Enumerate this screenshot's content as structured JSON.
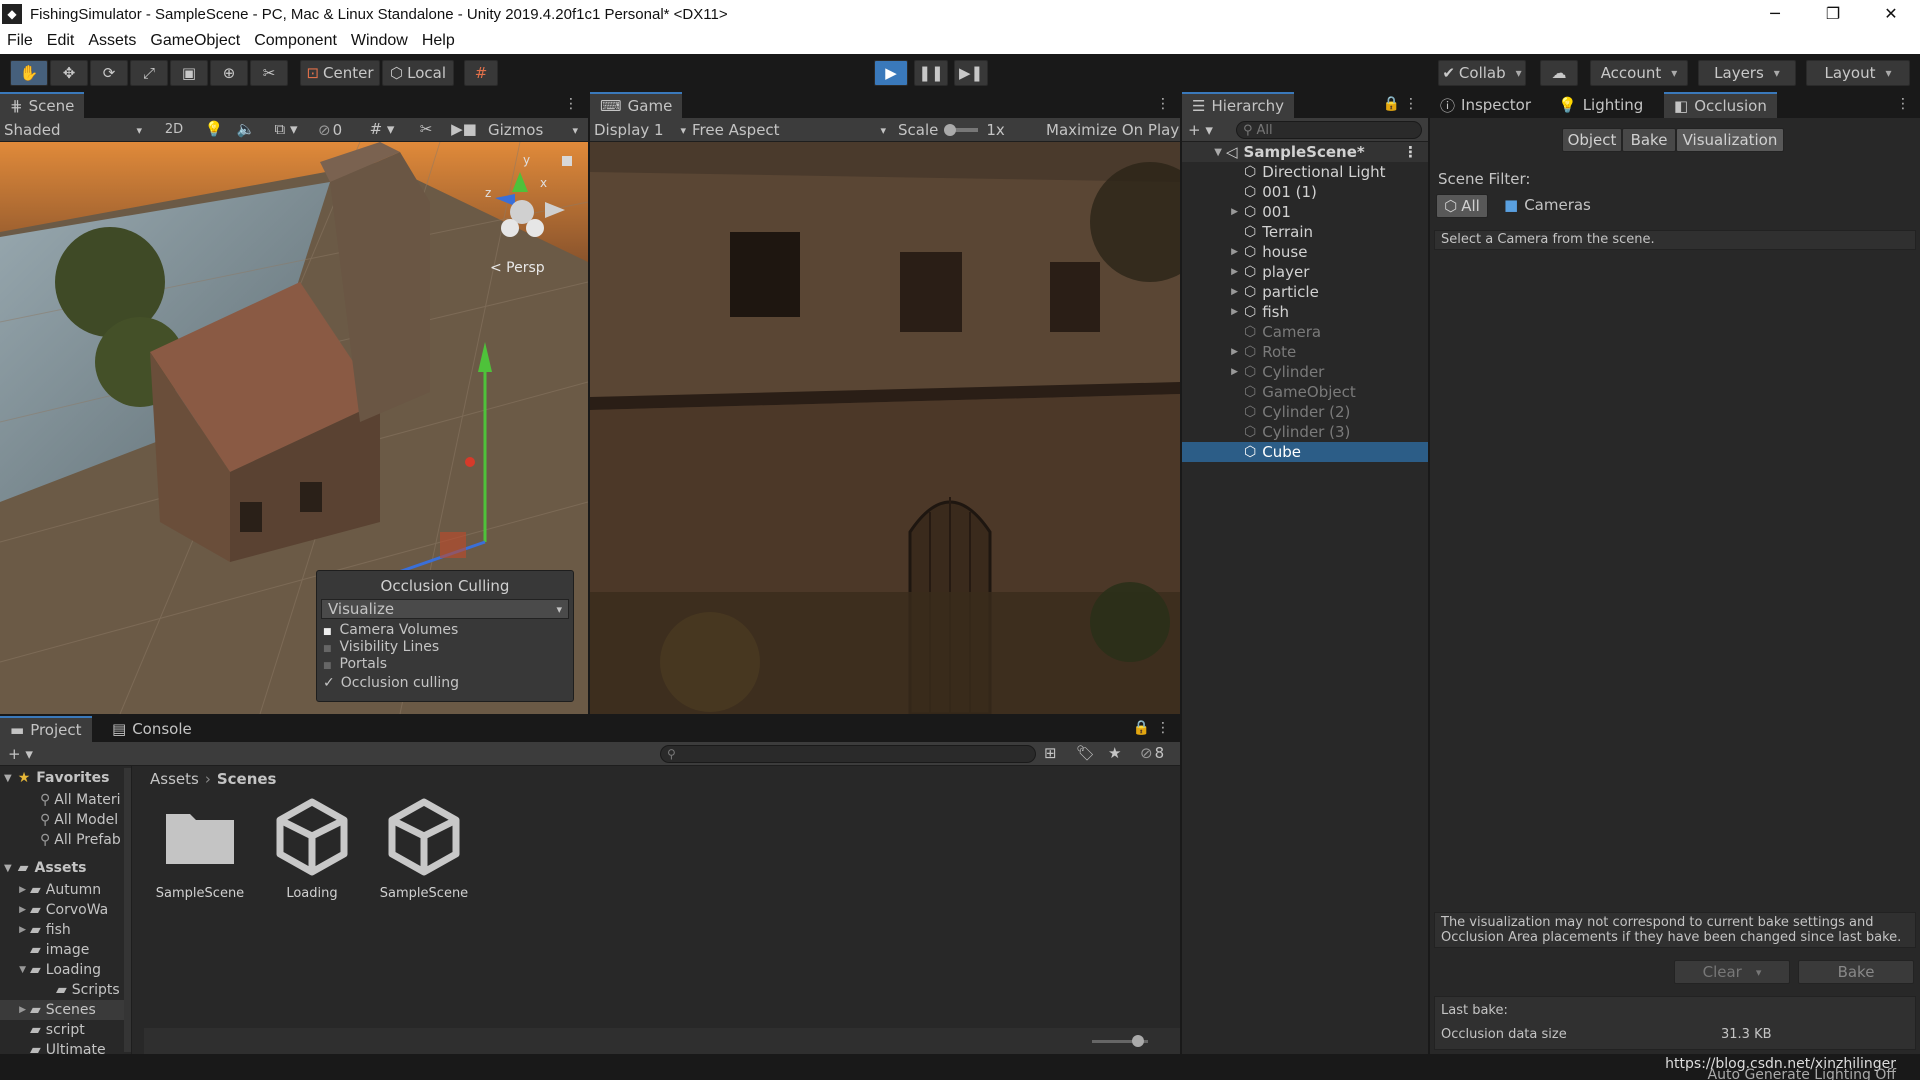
{
  "window": {
    "title": "FishingSimulator - SampleScene - PC, Mac & Linux Standalone - Unity 2019.4.20f1c1 Personal* <DX11>",
    "minimize": "─",
    "maximize": "❐",
    "close": "✕"
  },
  "menu": [
    "File",
    "Edit",
    "Assets",
    "GameObject",
    "Component",
    "Window",
    "Help"
  ],
  "toolbar": {
    "pivot_center": "Center",
    "pivot_local": "Local",
    "collab": "Collab",
    "account": "Account",
    "layers": "Layers",
    "layout": "Layout"
  },
  "scene_panel": {
    "tab": "Scene",
    "shading": "Shaded",
    "mode_2d": "2D",
    "hidden_count": "0",
    "gizmos": "Gizmos",
    "persp_label": "< Persp",
    "axis_x": "x",
    "axis_y": "y",
    "axis_z": "z",
    "occlusion_popup": {
      "title": "Occlusion Culling",
      "mode": "Visualize",
      "options": [
        "Camera Volumes",
        "Visibility Lines",
        "Portals"
      ],
      "culling_label": "Occlusion culling",
      "culling_checked": true
    }
  },
  "game_panel": {
    "tab": "Game",
    "display": "Display 1",
    "aspect": "Free Aspect",
    "scale_label": "Scale",
    "scale_value": "1x",
    "maximize": "Maximize On Play"
  },
  "hierarchy": {
    "tab": "Hierarchy",
    "search_placeholder": "All",
    "scene": "SampleScene*",
    "items": [
      {
        "label": "Directional Light",
        "expandable": false,
        "dim": false,
        "selected": false
      },
      {
        "label": "001 (1)",
        "expandable": false,
        "dim": false,
        "selected": false
      },
      {
        "label": "001",
        "expandable": true,
        "dim": false,
        "selected": false
      },
      {
        "label": "Terrain",
        "expandable": false,
        "dim": false,
        "selected": false
      },
      {
        "label": "house",
        "expandable": true,
        "dim": false,
        "selected": false
      },
      {
        "label": "player",
        "expandable": true,
        "dim": false,
        "selected": false
      },
      {
        "label": "particle",
        "expandable": true,
        "dim": false,
        "selected": false
      },
      {
        "label": "fish",
        "expandable": true,
        "dim": false,
        "selected": false
      },
      {
        "label": "Camera",
        "expandable": false,
        "dim": true,
        "selected": false
      },
      {
        "label": "Rote",
        "expandable": true,
        "dim": true,
        "selected": false
      },
      {
        "label": "Cylinder",
        "expandable": true,
        "dim": true,
        "selected": false
      },
      {
        "label": "GameObject",
        "expandable": false,
        "dim": true,
        "selected": false
      },
      {
        "label": "Cylinder (2)",
        "expandable": false,
        "dim": true,
        "selected": false
      },
      {
        "label": "Cylinder (3)",
        "expandable": false,
        "dim": true,
        "selected": false
      },
      {
        "label": "Cube",
        "expandable": false,
        "dim": false,
        "selected": true
      }
    ]
  },
  "inspector": {
    "tabs": [
      "Inspector",
      "Lighting",
      "Occlusion"
    ],
    "modes": [
      "Object",
      "Bake",
      "Visualization"
    ],
    "scene_filter_label": "Scene Filter:",
    "filter_all": "All",
    "filter_cameras": "Cameras",
    "hint": "Select a Camera from the scene.",
    "warning": "The visualization may not correspond to current bake settings and Occlusion Area placements if they have been changed since last bake.",
    "clear": "Clear",
    "bake": "Bake",
    "last_bake_label": "Last bake:",
    "data_size_label": "Occlusion data size",
    "data_size_value": "31.3 KB"
  },
  "project_panel": {
    "tabs": [
      "Project",
      "Console"
    ],
    "hidden_count": "8",
    "breadcrumb": [
      "Assets",
      "Scenes"
    ],
    "favorites_label": "Favorites",
    "favorites": [
      "All Materi",
      "All Model",
      "All Prefab"
    ],
    "assets_label": "Assets",
    "tree": [
      {
        "label": "Autumn",
        "indent": 1,
        "arrow": "▶",
        "selected": false
      },
      {
        "label": "CorvoWa",
        "indent": 1,
        "arrow": "▶",
        "selected": false
      },
      {
        "label": "fish",
        "indent": 1,
        "arrow": "▶",
        "selected": false
      },
      {
        "label": "image",
        "indent": 1,
        "arrow": "",
        "selected": false
      },
      {
        "label": "Loading",
        "indent": 1,
        "arrow": "▼",
        "selected": false
      },
      {
        "label": "Scripts",
        "indent": 2,
        "arrow": "",
        "selected": false
      },
      {
        "label": "Scenes",
        "indent": 1,
        "arrow": "▶",
        "selected": true
      },
      {
        "label": "script",
        "indent": 1,
        "arrow": "",
        "selected": false
      },
      {
        "label": "Ultimate",
        "indent": 1,
        "arrow": "",
        "selected": false
      }
    ],
    "assets": [
      {
        "label": "SampleScene",
        "type": "folder"
      },
      {
        "label": "Loading",
        "type": "unity"
      },
      {
        "label": "SampleScene",
        "type": "unity"
      }
    ]
  },
  "status": {
    "lighting": "Auto Generate Lighting Off",
    "watermark": "https://blog.csdn.net/xinzhilinger"
  }
}
